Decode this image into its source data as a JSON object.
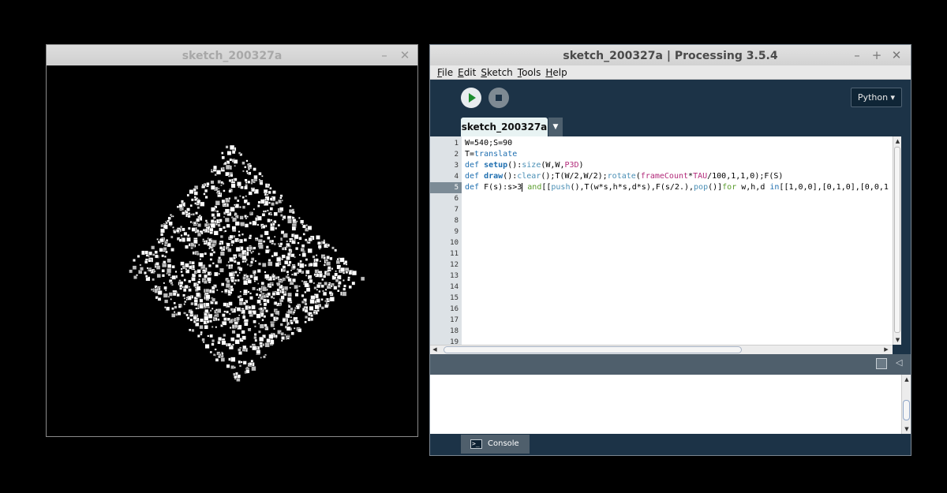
{
  "sketch_window": {
    "title": "sketch_200327a",
    "minimize_glyph": "–",
    "close_glyph": "✕"
  },
  "ide_window": {
    "title": "sketch_200327a | Processing 3.5.4",
    "minimize_glyph": "–",
    "maximize_glyph": "+",
    "close_glyph": "✕",
    "menu": [
      {
        "accel": "F",
        "rest": "ile"
      },
      {
        "accel": "E",
        "rest": "dit"
      },
      {
        "accel": "S",
        "rest": "ketch"
      },
      {
        "accel": "T",
        "rest": "ools"
      },
      {
        "accel": "H",
        "rest": "elp"
      }
    ],
    "toolbar": {
      "run_icon": "play-icon",
      "stop_icon": "stop-icon",
      "mode_label": "Python ▾"
    },
    "tab": {
      "label": "sketch_200327a",
      "menu_arrow": "▼"
    },
    "editor": {
      "active_line": 5,
      "line_numbers": [
        "1",
        "2",
        "3",
        "4",
        "5",
        "6",
        "7",
        "8",
        "9",
        "10",
        "11",
        "12",
        "13",
        "14",
        "15",
        "16",
        "17",
        "18",
        "19"
      ],
      "code_lines": [
        "W=540;S=90",
        "T=translate",
        "def setup():size(W,W,P3D)",
        "def draw():clear();T(W/2,W/2);rotate(frameCount*TAU/100,1,1,0);F(S)",
        "def F(s):s>3 and[[push(),T(w*s,h*s,d*s),F(s/2.),pop()]for w,h,d in[[1,0,0],[0,1,0],[0,0,1"
      ]
    },
    "console": {
      "tab_label": "Console",
      "tab_icon": "terminal-icon",
      "icon_glyph": ">_",
      "copy_icon": "copy-icon",
      "collapse_glyph": "◁"
    }
  },
  "colors": {
    "ide_background": "#1c3347",
    "editor_background": "#ffffff",
    "keyword": "#1f6fb0",
    "constant": "#b22a7a",
    "number_highlight": "#d0763d",
    "green_keyword": "#5b9d2d"
  }
}
